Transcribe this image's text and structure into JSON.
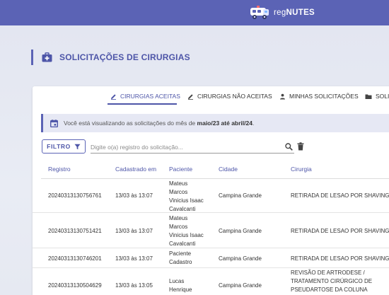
{
  "app": {
    "brand_prefix": "reg",
    "brand_suffix": "NUTES",
    "accent_color": "#5b63b5"
  },
  "page": {
    "title": "SOLICITAÇÕES DE CIRURGIAS",
    "icon": "medical-bag-icon"
  },
  "tabs": [
    {
      "label": "CIRURGIAS ACEITAS",
      "icon": "pencil-icon",
      "active": true
    },
    {
      "label": "CIRURGIAS NÃO ACEITAS",
      "icon": "pencil-icon",
      "active": false
    },
    {
      "label": "MINHAS SOLICITAÇÕES",
      "icon": "person-icon",
      "active": false
    },
    {
      "label": "SOLIC",
      "icon": "folder-icon",
      "active": false
    }
  ],
  "info": {
    "prefix": "Você está visualizando as solicitações do mês de ",
    "period": "maio/23 até abril/24",
    "suffix": "."
  },
  "filter": {
    "label": "FILTRO",
    "placeholder": "Digite o(a) registro do solicitação..."
  },
  "table": {
    "columns": [
      "Registro",
      "Cadastrado em",
      "Paciente",
      "Cidade",
      "Cirurgia"
    ],
    "rows": [
      {
        "registro": "20240313130756761",
        "cadastrado": "13/03 às 13:07",
        "paciente": [
          "Mateus",
          "Marcos",
          "Vinicius Isaac",
          "Cavalcanti"
        ],
        "cidade": "Campina Grande",
        "cirurgia": [
          "RETIRADA DE LESAO POR SHAVING"
        ]
      },
      {
        "registro": "20240313130751421",
        "cadastrado": "13/03 às 13:07",
        "paciente": [
          "Mateus",
          "Marcos",
          "Vinicius Isaac",
          "Cavalcanti"
        ],
        "cidade": "Campina Grande",
        "cirurgia": [
          "RETIRADA DE LESAO POR SHAVING"
        ]
      },
      {
        "registro": "20240313130746201",
        "cadastrado": "13/03 às 13:07",
        "paciente": [
          "Paciente",
          "Cadastro"
        ],
        "cidade": "Campina Grande",
        "cirurgia": [
          "RETIRADA DE LESAO POR SHAVING"
        ]
      },
      {
        "registro": "20240313130504629",
        "cadastrado": "13/03 às 13:05",
        "paciente": [
          "Lucas",
          "Henrique"
        ],
        "cidade": "Campina Grande",
        "cirurgia": [
          "REVISÃO DE ARTRODESE /",
          "TRATAMENTO CIRÚRGICO DE",
          "PSEUDARTOSE DA COLUNA"
        ]
      }
    ]
  }
}
